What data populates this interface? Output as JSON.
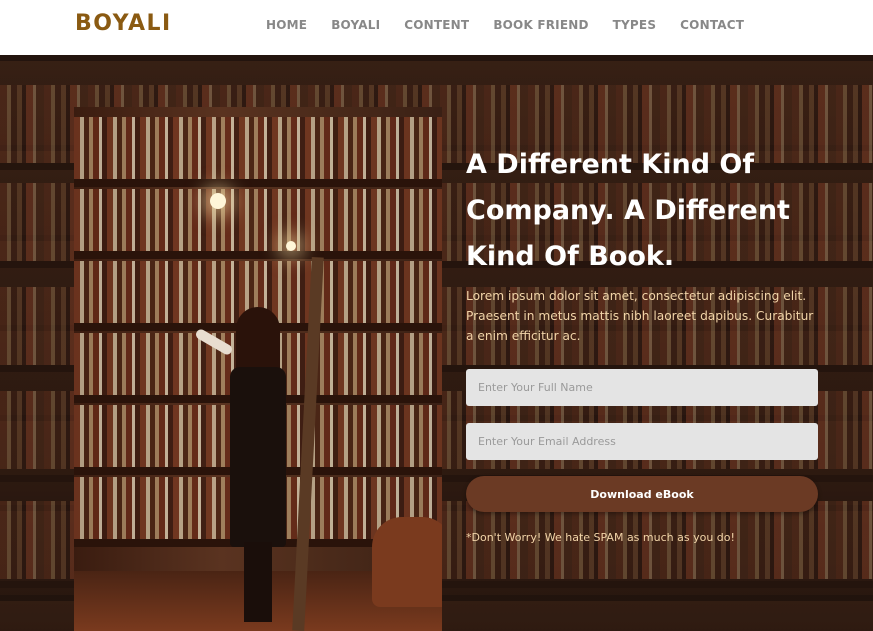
{
  "header": {
    "logo": "BOYALI",
    "nav": [
      "HOME",
      "BOYALI",
      "CONTENT",
      "BOOK FRIEND",
      "TYPES",
      "CONTACT"
    ]
  },
  "hero": {
    "headline_lines": [
      "A Different Kind Of",
      "Company. A Different",
      "Kind Of Book."
    ],
    "lead": "Lorem ipsum dolor sit amet, consectetur adipiscing elit. Praesent in metus mattis nibh laoreet dapibus. Curabitur a enim efficitur ac.",
    "form": {
      "name_placeholder": "Enter Your Full Name",
      "email_placeholder": "Enter Your Email Address",
      "submit_label": "Download eBook"
    },
    "note": "*Don't Worry! We hate SPAM as much as you do!"
  },
  "colors": {
    "brand": "#8a5a12",
    "button": "#6b3a24",
    "lead_text": "#f1d4a8"
  }
}
